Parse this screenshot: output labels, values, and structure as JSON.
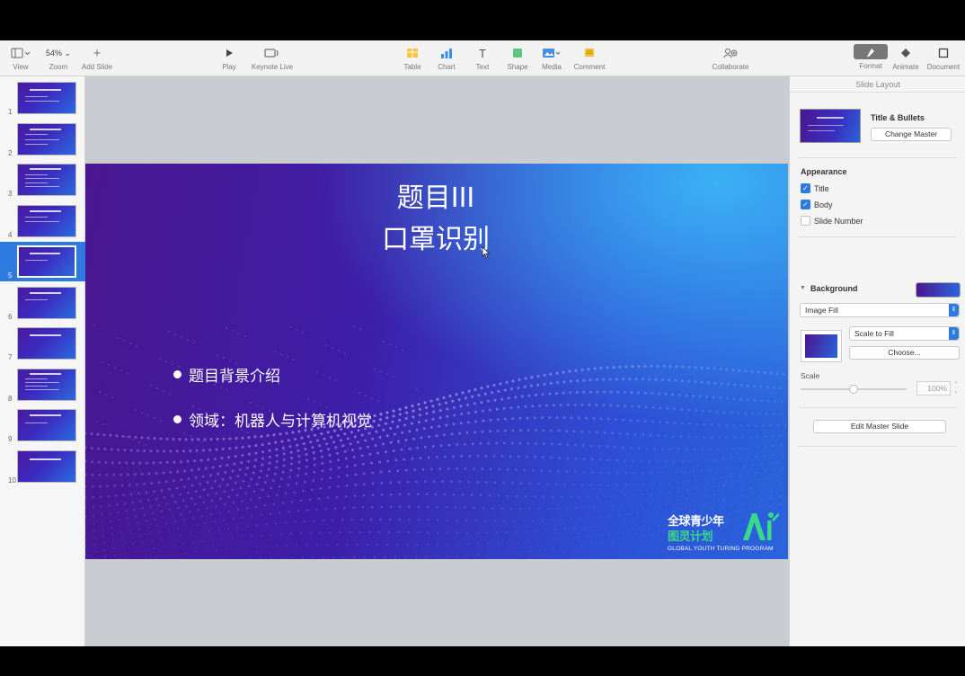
{
  "toolbar": {
    "view_label": "View",
    "zoom_value": "54%",
    "zoom_label": "Zoom",
    "add_slide_label": "Add Slide",
    "play_label": "Play",
    "keynote_live_label": "Keynote Live",
    "table_label": "Table",
    "chart_label": "Chart",
    "text_label": "Text",
    "shape_label": "Shape",
    "media_label": "Media",
    "comment_label": "Comment",
    "collaborate_label": "Collaborate",
    "format_label": "Format",
    "animate_label": "Animate",
    "document_label": "Document"
  },
  "navigator": {
    "slides": [
      {
        "number": "1"
      },
      {
        "number": "2"
      },
      {
        "number": "3"
      },
      {
        "number": "4"
      },
      {
        "number": "5"
      },
      {
        "number": "6"
      },
      {
        "number": "7"
      },
      {
        "number": "8"
      },
      {
        "number": "9"
      },
      {
        "number": "10"
      }
    ],
    "selected": "5"
  },
  "slide": {
    "title_line1": "题目III",
    "title_line2": "口罩识别",
    "bullets": [
      "题目背景介绍",
      "领域：机器人与计算机视觉"
    ],
    "logo": {
      "line1": "全球青少年",
      "line2": "图灵计划",
      "line3": "GLOBAL YOUTH TURING PROGRAM"
    }
  },
  "inspector": {
    "header": "Slide Layout",
    "master_name": "Title & Bullets",
    "change_master_label": "Change Master",
    "appearance_label": "Appearance",
    "appearance_options": [
      {
        "label": "Title",
        "checked": true
      },
      {
        "label": "Body",
        "checked": true
      },
      {
        "label": "Slide Number",
        "checked": false
      }
    ],
    "background_label": "Background",
    "fill_type": "Image Fill",
    "scale_mode": "Scale to Fill",
    "choose_label": "Choose...",
    "scale_label": "Scale",
    "scale_value": "100%",
    "scale_fraction": 0.5,
    "edit_master_label": "Edit Master Slide"
  },
  "colors": {
    "accent": "#2d7be0",
    "slide_purple": "#4a1690",
    "slide_blue": "#2a64dc",
    "logo_green": "#39d98a"
  }
}
